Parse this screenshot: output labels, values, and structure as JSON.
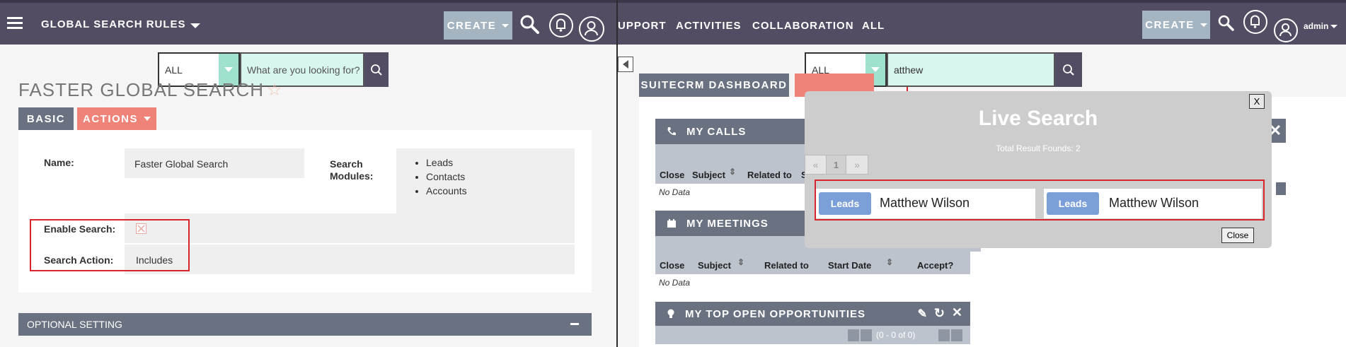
{
  "left": {
    "header": {
      "title": "GLOBAL SEARCH RULES",
      "create_label": "CREATE"
    },
    "search": {
      "scope": "ALL",
      "placeholder": "What are you looking for?"
    },
    "page_title": "FASTER GLOBAL SEARCH",
    "tabs": {
      "basic": "BASIC",
      "actions": "ACTIONS"
    },
    "detail": {
      "name_label": "Name:",
      "name_value": "Faster Global Search",
      "modules_label": "Search Modules:",
      "modules": [
        "Leads",
        "Contacts",
        "Accounts"
      ],
      "enable_label": "Enable Search:",
      "action_label": "Search Action:",
      "action_value": "Includes"
    },
    "optional_setting": "OPTIONAL SETTING"
  },
  "right": {
    "nav": {
      "support": "UPPORT",
      "activities": "ACTIVITIES",
      "collaboration": "COLLABORATION",
      "all": "ALL"
    },
    "header": {
      "create_label": "CREATE",
      "user": "admin"
    },
    "search": {
      "scope": "ALL",
      "query": "atthew"
    },
    "dashboard_tab": "SUITECRM DASHBOARD",
    "calls": {
      "title": "MY CALLS",
      "columns": [
        "Close",
        "Subject",
        "Related to",
        "S"
      ],
      "no_data": "No Data"
    },
    "meetings": {
      "title": "MY MEETINGS",
      "columns": [
        "Close",
        "Subject",
        "Related to",
        "Start Date",
        "Accept?"
      ],
      "no_data": "No Data"
    },
    "opportunities": {
      "title": "MY TOP OPEN OPPORTUNITIES",
      "pagination": "(0 - 0 of 0)"
    },
    "live_search": {
      "title": "Live Search",
      "total": "Total Result Founds: 2",
      "close_x": "X",
      "page": "1",
      "prev": "«",
      "next": "»",
      "results": [
        {
          "module": "Leads",
          "name": "Matthew Wilson"
        },
        {
          "module": "Leads",
          "name": "Matthew Wilson"
        }
      ],
      "close_label": "Close"
    }
  }
}
